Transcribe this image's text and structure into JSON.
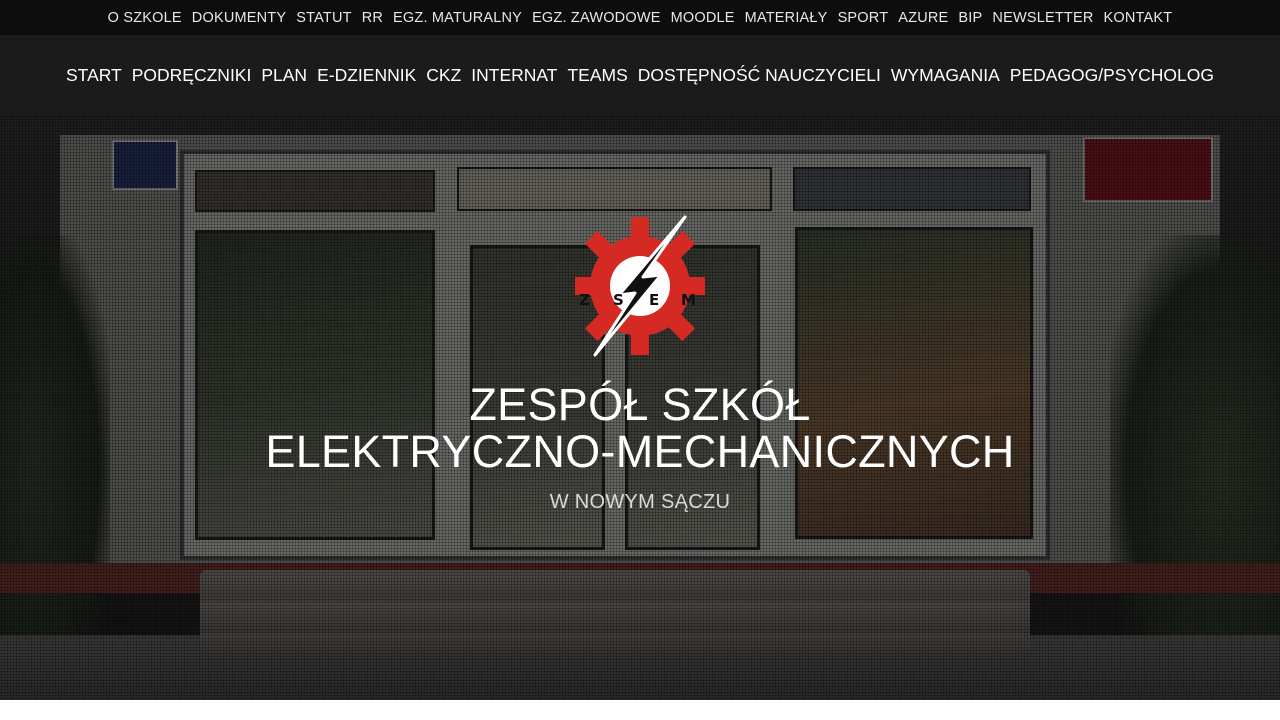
{
  "top_nav": {
    "items": [
      {
        "label": "O SZKOLE"
      },
      {
        "label": "DOKUMENTY"
      },
      {
        "label": "STATUT"
      },
      {
        "label": "RR"
      },
      {
        "label": "EGZ. MATURALNY"
      },
      {
        "label": "EGZ. ZAWODOWE"
      },
      {
        "label": "MOODLE"
      },
      {
        "label": "MATERIAŁY"
      },
      {
        "label": "SPORT"
      },
      {
        "label": "AZURE"
      },
      {
        "label": "BIP"
      },
      {
        "label": "NEWSLETTER"
      },
      {
        "label": "KONTAKT"
      }
    ]
  },
  "main_nav": {
    "items": [
      {
        "label": "START"
      },
      {
        "label": "PODRĘCZNIKI"
      },
      {
        "label": "PLAN"
      },
      {
        "label": "E-DZIENNIK"
      },
      {
        "label": "CKZ"
      },
      {
        "label": "INTERNAT"
      },
      {
        "label": "TEAMS"
      },
      {
        "label": "DOSTĘPNOŚĆ NAUCZYCIELI"
      },
      {
        "label": "WYMAGANIA"
      },
      {
        "label": "PEDAGOG/PSYCHOLOG"
      }
    ]
  },
  "hero": {
    "logo": {
      "icon": "gear-lightning-logo-icon",
      "letters": "ZSEM",
      "gear_color": "#d42a23",
      "bolt_color": "#111111"
    },
    "title_line1": "ZESPÓŁ SZKÓŁ",
    "title_line2": "ELEKTRYCZNO-MECHANICZNYCH",
    "subtitle": "W NOWYM SĄCZU"
  },
  "colors": {
    "top_bar_bg": "#0d0d0d",
    "main_bar_bg": "#1b1b1b",
    "text": "#ffffff"
  }
}
